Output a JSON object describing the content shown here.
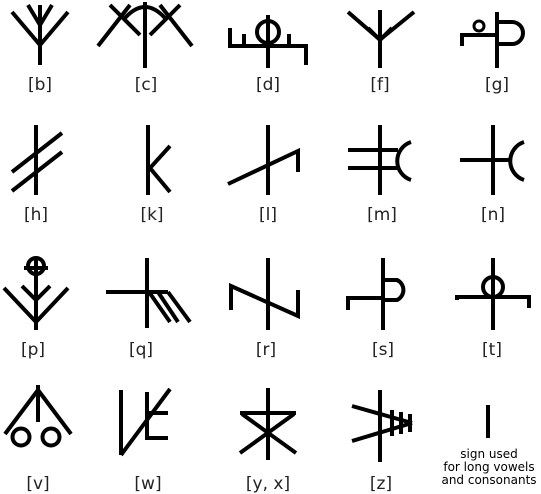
{
  "ink_color": "#000000",
  "label_color": "#222222",
  "glyphs": [
    {
      "id": "b",
      "label": "[b]"
    },
    {
      "id": "c",
      "label": "[c]"
    },
    {
      "id": "d",
      "label": "[d]"
    },
    {
      "id": "f",
      "label": "[f]"
    },
    {
      "id": "g",
      "label": "[g]"
    },
    {
      "id": "h",
      "label": "[h]"
    },
    {
      "id": "k",
      "label": "[k]"
    },
    {
      "id": "l",
      "label": "[l]"
    },
    {
      "id": "m",
      "label": "[m]"
    },
    {
      "id": "n",
      "label": "[n]"
    },
    {
      "id": "p",
      "label": "[p]"
    },
    {
      "id": "q",
      "label": "[q]"
    },
    {
      "id": "r",
      "label": "[r]"
    },
    {
      "id": "s",
      "label": "[s]"
    },
    {
      "id": "t",
      "label": "[t]"
    },
    {
      "id": "v",
      "label": "[v]"
    },
    {
      "id": "w",
      "label": "[w]"
    },
    {
      "id": "yx",
      "label": "[y, x]"
    },
    {
      "id": "z",
      "label": "[z]"
    }
  ],
  "long_sign": {
    "line1": "sign used",
    "line2": "for long vowels",
    "line3": "and consonants"
  }
}
